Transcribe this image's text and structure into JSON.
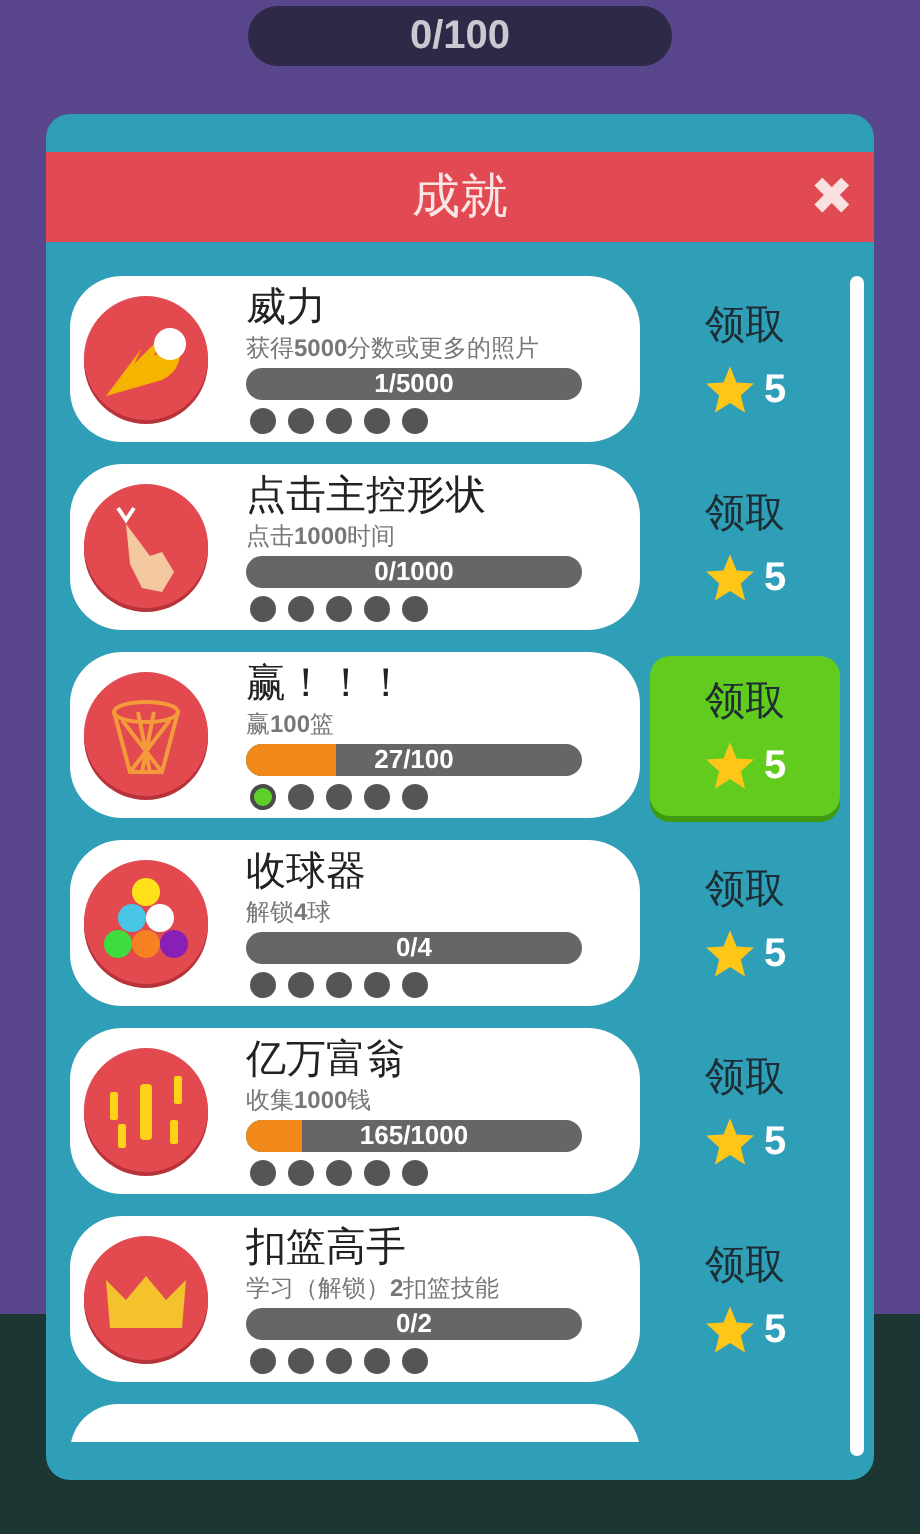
{
  "counter": "0/100",
  "dialog": {
    "title": "成就",
    "close": "✖"
  },
  "achievements": [
    {
      "kind": "fireball",
      "title": "威力",
      "desc": "获得**5000**分数或更多的照片",
      "progress": "1/5000",
      "level": 0.0002,
      "dots": [
        false,
        false,
        false,
        false,
        false
      ],
      "claim": "领取",
      "reward": "5",
      "claimable": false
    },
    {
      "kind": "finger",
      "title": "点击主控形状",
      "desc": "点击**1000**时间",
      "progress": "0/1000",
      "level": 0,
      "dots": [
        false,
        false,
        false,
        false,
        false
      ],
      "claim": "领取",
      "reward": "5",
      "claimable": false
    },
    {
      "kind": "hoop",
      "title": "赢！！！",
      "desc": "赢**100**篮",
      "progress": "27/100",
      "level": 0.27,
      "dots": [
        true,
        false,
        false,
        false,
        false
      ],
      "claim": "领取",
      "reward": "5",
      "claimable": true
    },
    {
      "kind": "balls",
      "title": "收球器",
      "desc": "解锁**4**球",
      "progress": "0/4",
      "level": 0,
      "dots": [
        false,
        false,
        false,
        false,
        false
      ],
      "claim": "领取",
      "reward": "5",
      "claimable": false
    },
    {
      "kind": "dollars",
      "title": "亿万富翁",
      "desc": "收集**1000**钱",
      "progress": "165/1000",
      "level": 0.165,
      "dots": [
        false,
        false,
        false,
        false,
        false
      ],
      "claim": "领取",
      "reward": "5",
      "claimable": false
    },
    {
      "kind": "crown",
      "title": "扣篮高手",
      "desc": "学习（解锁）**2**扣篮技能",
      "progress": "0/2",
      "level": 0,
      "dots": [
        false,
        false,
        false,
        false,
        false
      ],
      "claim": "领取",
      "reward": "5",
      "claimable": false
    }
  ]
}
